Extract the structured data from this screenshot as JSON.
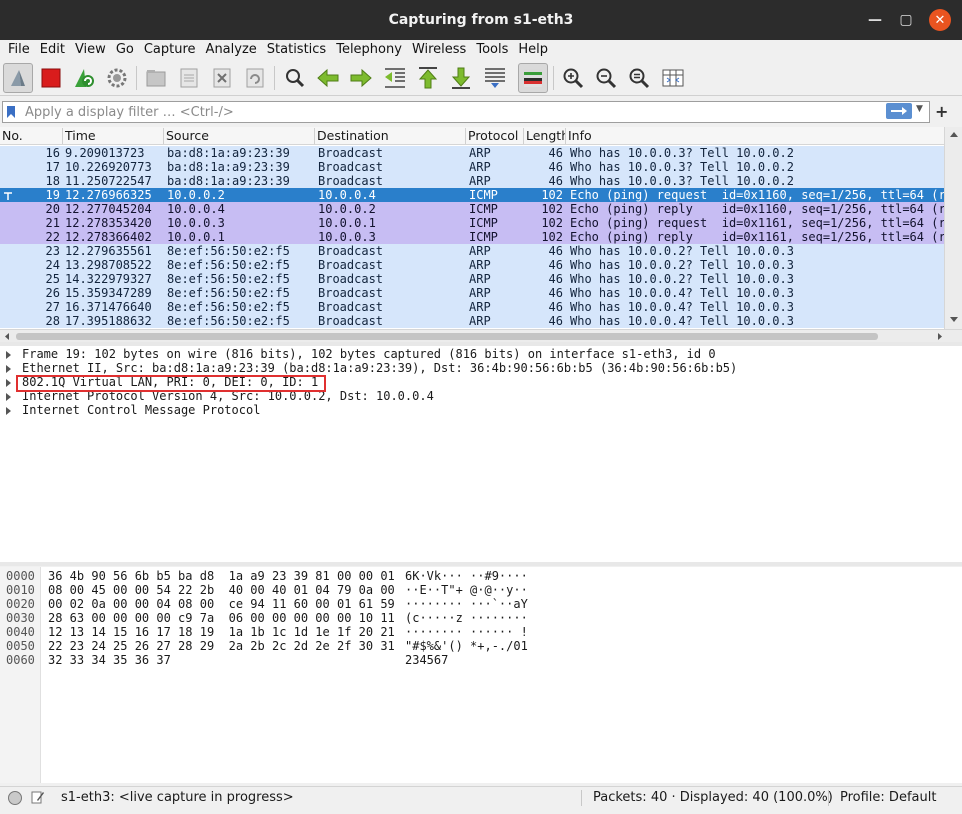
{
  "window": {
    "title": "Capturing from s1-eth3"
  },
  "menu": [
    "File",
    "Edit",
    "View",
    "Go",
    "Capture",
    "Analyze",
    "Statistics",
    "Telephony",
    "Wireless",
    "Tools",
    "Help"
  ],
  "filter": {
    "placeholder": "Apply a display filter … <Ctrl-/>",
    "value": ""
  },
  "columns": {
    "no": "No.",
    "time": "Time",
    "source": "Source",
    "destination": "Destination",
    "protocol": "Protocol",
    "length": "Length",
    "info": "Info"
  },
  "colors": {
    "arp_row": "#d6e6fb",
    "icmp_row": "#c7bdf3",
    "selected_row": "#2a7fcb",
    "highlight_box": "#e03030",
    "accent": "#e95420"
  },
  "packets": [
    {
      "no": "16",
      "time": "9.209013723",
      "source": "ba:d8:1a:a9:23:39",
      "destination": "Broadcast",
      "protocol": "ARP",
      "length": "46",
      "info": "Who has 10.0.0.3? Tell 10.0.0.2",
      "kind": "arp"
    },
    {
      "no": "17",
      "time": "10.226920773",
      "source": "ba:d8:1a:a9:23:39",
      "destination": "Broadcast",
      "protocol": "ARP",
      "length": "46",
      "info": "Who has 10.0.0.3? Tell 10.0.0.2",
      "kind": "arp"
    },
    {
      "no": "18",
      "time": "11.250722547",
      "source": "ba:d8:1a:a9:23:39",
      "destination": "Broadcast",
      "protocol": "ARP",
      "length": "46",
      "info": "Who has 10.0.0.3? Tell 10.0.0.2",
      "kind": "arp"
    },
    {
      "no": "19",
      "time": "12.276966325",
      "source": "10.0.0.2",
      "destination": "10.0.0.4",
      "protocol": "ICMP",
      "length": "102",
      "info": "Echo (ping) request  id=0x1160, seq=1/256, ttl=64 (r",
      "kind": "selected"
    },
    {
      "no": "20",
      "time": "12.277045204",
      "source": "10.0.0.4",
      "destination": "10.0.0.2",
      "protocol": "ICMP",
      "length": "102",
      "info": "Echo (ping) reply    id=0x1160, seq=1/256, ttl=64 (r",
      "kind": "icmp"
    },
    {
      "no": "21",
      "time": "12.278353420",
      "source": "10.0.0.3",
      "destination": "10.0.0.1",
      "protocol": "ICMP",
      "length": "102",
      "info": "Echo (ping) request  id=0x1161, seq=1/256, ttl=64 (r",
      "kind": "icmp"
    },
    {
      "no": "22",
      "time": "12.278366402",
      "source": "10.0.0.1",
      "destination": "10.0.0.3",
      "protocol": "ICMP",
      "length": "102",
      "info": "Echo (ping) reply    id=0x1161, seq=1/256, ttl=64 (r",
      "kind": "icmp"
    },
    {
      "no": "23",
      "time": "12.279635561",
      "source": "8e:ef:56:50:e2:f5",
      "destination": "Broadcast",
      "protocol": "ARP",
      "length": "46",
      "info": "Who has 10.0.0.2? Tell 10.0.0.3",
      "kind": "arp"
    },
    {
      "no": "24",
      "time": "13.298708522",
      "source": "8e:ef:56:50:e2:f5",
      "destination": "Broadcast",
      "protocol": "ARP",
      "length": "46",
      "info": "Who has 10.0.0.2? Tell 10.0.0.3",
      "kind": "arp"
    },
    {
      "no": "25",
      "time": "14.322979327",
      "source": "8e:ef:56:50:e2:f5",
      "destination": "Broadcast",
      "protocol": "ARP",
      "length": "46",
      "info": "Who has 10.0.0.2? Tell 10.0.0.3",
      "kind": "arp"
    },
    {
      "no": "26",
      "time": "15.359347289",
      "source": "8e:ef:56:50:e2:f5",
      "destination": "Broadcast",
      "protocol": "ARP",
      "length": "46",
      "info": "Who has 10.0.0.4? Tell 10.0.0.3",
      "kind": "arp"
    },
    {
      "no": "27",
      "time": "16.371476640",
      "source": "8e:ef:56:50:e2:f5",
      "destination": "Broadcast",
      "protocol": "ARP",
      "length": "46",
      "info": "Who has 10.0.0.4? Tell 10.0.0.3",
      "kind": "arp"
    },
    {
      "no": "28",
      "time": "17.395188632",
      "source": "8e:ef:56:50:e2:f5",
      "destination": "Broadcast",
      "protocol": "ARP",
      "length": "46",
      "info": "Who has 10.0.0.4? Tell 10.0.0.3",
      "kind": "arp"
    }
  ],
  "details": [
    "Frame 19: 102 bytes on wire (816 bits), 102 bytes captured (816 bits) on interface s1-eth3, id 0",
    "Ethernet II, Src: ba:d8:1a:a9:23:39 (ba:d8:1a:a9:23:39), Dst: 36:4b:90:56:6b:b5 (36:4b:90:56:6b:b5)",
    "802.1Q Virtual LAN, PRI: 0, DEI: 0, ID: 1",
    "Internet Protocol Version 4, Src: 10.0.0.2, Dst: 10.0.0.4",
    "Internet Control Message Protocol"
  ],
  "bytes": [
    {
      "offset": "0000",
      "hex": "36 4b 90 56 6b b5 ba d8  1a a9 23 39 81 00 00 01",
      "ascii": "6K·Vk··· ··#9····"
    },
    {
      "offset": "0010",
      "hex": "08 00 45 00 00 54 22 2b  40 00 40 01 04 79 0a 00",
      "ascii": "··E··T\"+ @·@··y··"
    },
    {
      "offset": "0020",
      "hex": "00 02 0a 00 00 04 08 00  ce 94 11 60 00 01 61 59",
      "ascii": "········ ···`··aY"
    },
    {
      "offset": "0030",
      "hex": "28 63 00 00 00 00 c9 7a  06 00 00 00 00 00 10 11",
      "ascii": "(c·····z ········"
    },
    {
      "offset": "0040",
      "hex": "12 13 14 15 16 17 18 19  1a 1b 1c 1d 1e 1f 20 21",
      "ascii": "········ ······ !"
    },
    {
      "offset": "0050",
      "hex": "22 23 24 25 26 27 28 29  2a 2b 2c 2d 2e 2f 30 31",
      "ascii": "\"#$%&'() *+,-./01"
    },
    {
      "offset": "0060",
      "hex": "32 33 34 35 36 37",
      "ascii": "234567"
    }
  ],
  "status": {
    "interface_text": "s1-eth3: <live capture in progress>",
    "packets_text": "Packets: 40 · Displayed: 40 (100.0%)",
    "profile_text": "Profile: Default"
  }
}
